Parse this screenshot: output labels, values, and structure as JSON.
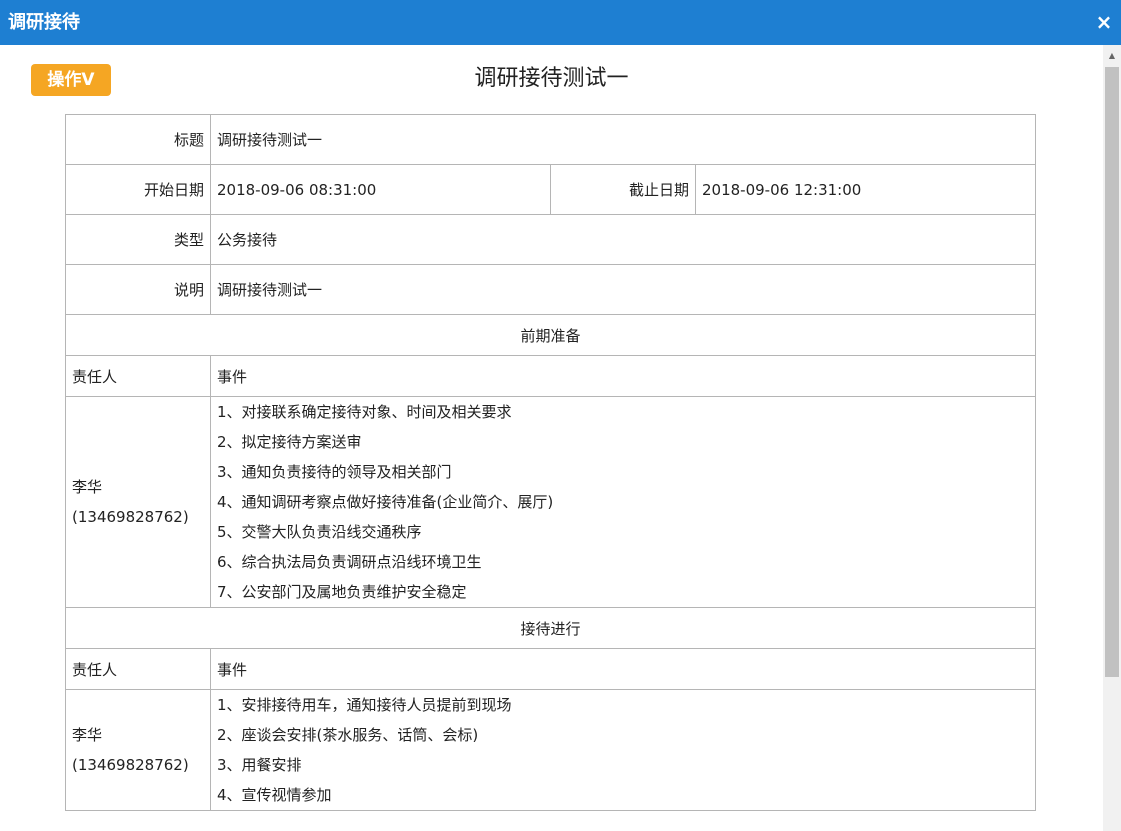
{
  "window": {
    "title": "调研接待",
    "close_glyph": "×"
  },
  "actions": {
    "operate_label": "操作V"
  },
  "document": {
    "title": "调研接待测试一",
    "fields": {
      "title_label": "标题",
      "title_value": "调研接待测试一",
      "start_label": "开始日期",
      "start_value": "2018-09-06 08:31:00",
      "end_label": "截止日期",
      "end_value": "2018-09-06 12:31:00",
      "type_label": "类型",
      "type_value": "公务接待",
      "desc_label": "说明",
      "desc_value": "调研接待测试一"
    },
    "sections": [
      {
        "name": "前期准备",
        "col_responsible": "责任人",
        "col_event": "事件",
        "responsible_name": "李华",
        "responsible_phone": "(13469828762)",
        "tasks": [
          "1、对接联系确定接待对象、时间及相关要求",
          "2、拟定接待方案送审",
          "3、通知负责接待的领导及相关部门",
          "4、通知调研考察点做好接待准备(企业简介、展厅)",
          "5、交警大队负责沿线交通秩序",
          "6、综合执法局负责调研点沿线环境卫生",
          "7、公安部门及属地负责维护安全稳定"
        ]
      },
      {
        "name": "接待进行",
        "col_responsible": "责任人",
        "col_event": "事件",
        "responsible_name": "李华",
        "responsible_phone": "(13469828762)",
        "tasks": [
          "1、安排接待用车，通知接待人员提前到现场",
          "2、座谈会安排(茶水服务、话筒、会标)",
          "3、用餐安排",
          "4、宣传视情参加"
        ]
      }
    ]
  },
  "scrollbar": {
    "up_glyph": "▲"
  },
  "colors": {
    "titlebar": "#1e7fd2",
    "operate_button": "#f5a623",
    "border": "#b5b5b5"
  }
}
